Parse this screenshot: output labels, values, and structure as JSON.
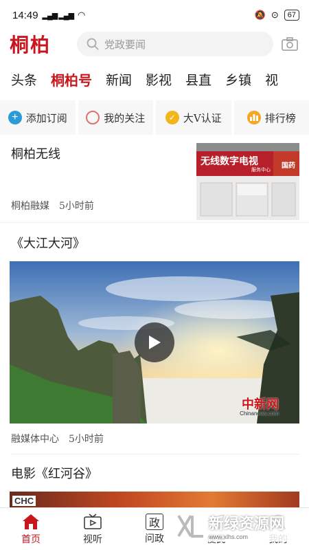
{
  "status_bar": {
    "time": "14:49",
    "signal": "5G",
    "network": "HD",
    "battery": "67"
  },
  "header": {
    "logo": "桐柏",
    "search_placeholder": "党政要闻"
  },
  "tabs": [
    "头条",
    "桐柏号",
    "新闻",
    "影视",
    "县直",
    "乡镇",
    "视"
  ],
  "active_tab_index": 1,
  "actions": [
    {
      "label": "添加订阅",
      "icon": "plus-circle-icon",
      "color": "#2a9bd8"
    },
    {
      "label": "我的关注",
      "icon": "circle-icon",
      "color": "#e07070"
    },
    {
      "label": "大V认证",
      "icon": "check-circle-icon",
      "color": "#f2b51c"
    },
    {
      "label": "排行榜",
      "icon": "bar-chart-icon",
      "color": "#f5a623"
    }
  ],
  "feed": {
    "item1": {
      "title": "桐柏无线",
      "source": "桐柏融媒",
      "time": "5小时前",
      "thumb_sign": "无线数字电视",
      "thumb_sub": "服务中心",
      "thumb_right": "国药"
    },
    "item2": {
      "title": "《大江大河》",
      "source": "融媒体中心",
      "time": "5小时前",
      "watermark": "中新网",
      "watermark_sub": "Chinanews.com"
    },
    "item3": {
      "title": "电影《红河谷》",
      "badge": "CHC"
    }
  },
  "bottom_nav": [
    {
      "label": "首页",
      "icon": "home-icon"
    },
    {
      "label": "视听",
      "icon": "tv-icon"
    },
    {
      "label": "问政",
      "icon": "zheng-icon",
      "glyph": "政"
    },
    {
      "label": "便民",
      "icon": "send-icon"
    },
    {
      "label": "我的",
      "icon": "user-icon"
    }
  ],
  "overlay_watermark": {
    "brand": "新绿资源网",
    "sub": "www.xlhs.com"
  },
  "colors": {
    "brand_red": "#c9161c",
    "action_bg": "#f7f7f7"
  }
}
